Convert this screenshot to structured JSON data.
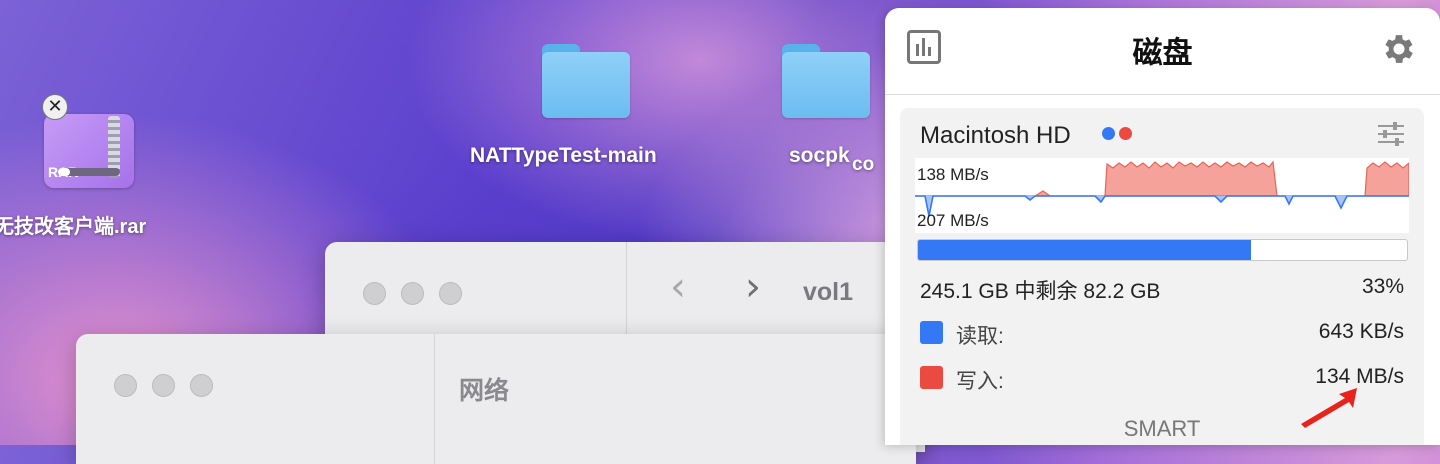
{
  "desktop": {
    "rar_file": {
      "label": "无技改客户端.rar",
      "badge": "RAR"
    },
    "folders": [
      {
        "label": "NATTypeTest-main"
      },
      {
        "label": "socpk"
      },
      {
        "label": "co"
      }
    ]
  },
  "windows": {
    "finder_back": {
      "nav_back": "‹",
      "nav_forward": "›",
      "title": "vol1"
    },
    "finder_front": {
      "sidebar_label": "网络"
    }
  },
  "disk_panel": {
    "title": "磁盘",
    "drive": {
      "name": "Macintosh HD",
      "read_speed_label": "138 MB/s",
      "write_speed_label": "207 MB/s",
      "usage_fraction": 0.68,
      "usage_text": "245.1 GB 中剩余 82.2 GB",
      "usage_percent": "33%",
      "read_label": "读取:",
      "read_value": "643 KB/s",
      "write_label": "写入:",
      "write_value": "134 MB/s",
      "smart_label": "SMART"
    },
    "colors": {
      "read": "#3478f6",
      "write": "#ea4a3f"
    }
  }
}
